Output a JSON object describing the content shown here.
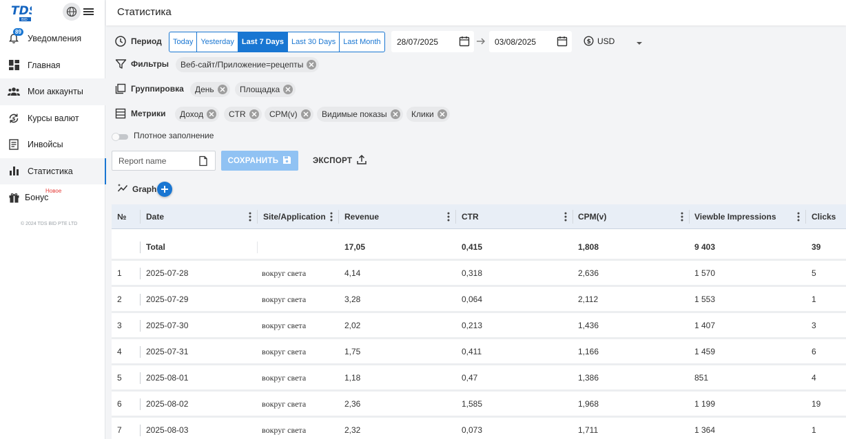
{
  "sidebar": {
    "logo_text": "TDS",
    "notification_count": "89",
    "items": [
      {
        "label": "Уведомления",
        "icon": "bell-icon"
      },
      {
        "label": "Главная",
        "icon": "dashboard-icon"
      },
      {
        "label": "Мои аккаунты",
        "icon": "users-icon"
      },
      {
        "label": "Курсы валют",
        "icon": "currency-exchange-icon"
      },
      {
        "label": "Инвойсы",
        "icon": "invoice-icon"
      },
      {
        "label": "Статистика",
        "icon": "bar-chart-icon"
      },
      {
        "label": "Бонус",
        "icon": "gift-icon"
      }
    ],
    "new_tag": "Новое",
    "copyright": "© 2024 TDS BID PTE LTD"
  },
  "header": {
    "title": "Статистика"
  },
  "period": {
    "label": "Период",
    "options": [
      "Today",
      "Yesterday",
      "Last 7 Days",
      "Last 30 Days",
      "Last Month"
    ],
    "selected": "Last 7 Days",
    "date_from": "28/07/2025",
    "date_to": "03/08/2025",
    "currency": "USD"
  },
  "filters": {
    "label": "Фильтры",
    "chips": [
      "Веб-сайт/Приложение=рецепты"
    ]
  },
  "grouping": {
    "label": "Группировка",
    "chips": [
      "День",
      "Площадка"
    ]
  },
  "metrics": {
    "label": "Метрики",
    "chips": [
      "Доход",
      "CTR",
      "CPM(v)",
      "Видимые показы",
      "Клики"
    ]
  },
  "dense": {
    "label": "Плотное заполнение"
  },
  "report": {
    "placeholder": "Report name",
    "save_label": "СОХРАНИТЬ",
    "export_label": "ЭКСПОРТ"
  },
  "graph": {
    "label": "Graph"
  },
  "table": {
    "columns": [
      "№",
      "Date",
      "Site/Application",
      "Revenue",
      "CTR",
      "CPM(v)",
      "Viewble Impressions",
      "Clicks"
    ],
    "total": {
      "label": "Total",
      "revenue": "17,05",
      "ctr": "0,415",
      "cpm": "1,808",
      "impressions": "9 403",
      "clicks": "39"
    },
    "rows": [
      {
        "n": "1",
        "date": "2025-07-28",
        "site": "вокруг света",
        "revenue": "4,14",
        "ctr": "0,318",
        "cpm": "2,636",
        "impressions": "1 570",
        "clicks": "5"
      },
      {
        "n": "2",
        "date": "2025-07-29",
        "site": "вокруг света",
        "revenue": "3,28",
        "ctr": "0,064",
        "cpm": "2,112",
        "impressions": "1 553",
        "clicks": "1"
      },
      {
        "n": "3",
        "date": "2025-07-30",
        "site": "вокруг света",
        "revenue": "2,02",
        "ctr": "0,213",
        "cpm": "1,436",
        "impressions": "1 407",
        "clicks": "3"
      },
      {
        "n": "4",
        "date": "2025-07-31",
        "site": "вокруг света",
        "revenue": "1,75",
        "ctr": "0,411",
        "cpm": "1,166",
        "impressions": "1 459",
        "clicks": "6"
      },
      {
        "n": "5",
        "date": "2025-08-01",
        "site": "вокруг света",
        "revenue": "1,18",
        "ctr": "0,47",
        "cpm": "1,386",
        "impressions": "851",
        "clicks": "4"
      },
      {
        "n": "6",
        "date": "2025-08-02",
        "site": "вокруг света",
        "revenue": "2,36",
        "ctr": "1,585",
        "cpm": "1,968",
        "impressions": "1 199",
        "clicks": "19"
      },
      {
        "n": "7",
        "date": "2025-08-03",
        "site": "вокруг света",
        "revenue": "2,32",
        "ctr": "0,073",
        "cpm": "1,711",
        "impressions": "1 364",
        "clicks": "1"
      }
    ]
  },
  "colors": {
    "accent": "#1976d2",
    "save_button": "#90c2f3",
    "new_tag": "#e53935"
  }
}
